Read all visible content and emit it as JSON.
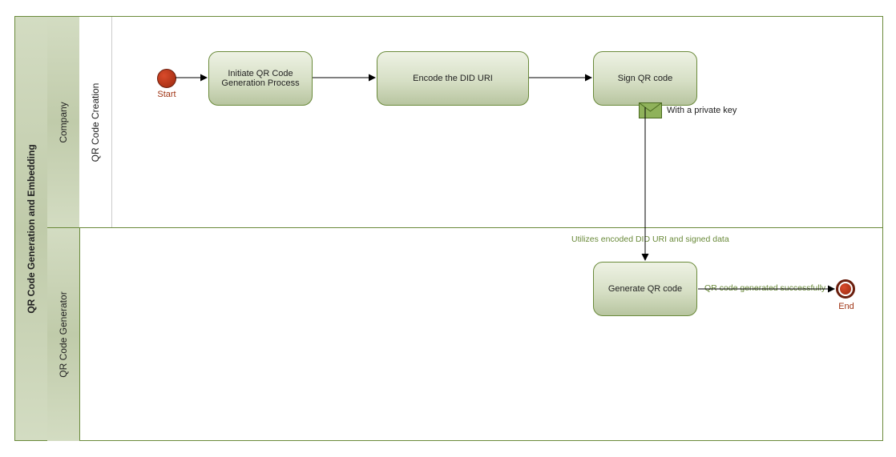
{
  "pool": {
    "title": "QR Code Generation and Embedding"
  },
  "lanes": {
    "company": "Company",
    "generator": "QR Code Generator",
    "sublane": "QR Code Creation"
  },
  "events": {
    "start": "Start",
    "end": "End"
  },
  "tasks": {
    "initiate": "Initiate QR Code Generation Process",
    "encode": "Encode the DID URI",
    "sign": "Sign QR code",
    "generate": "Generate QR code"
  },
  "messages": {
    "private_key": "With a private key"
  },
  "flows": {
    "utilize": "Utilizes encoded DID URI and signed data",
    "success": "QR code generated successfully"
  }
}
